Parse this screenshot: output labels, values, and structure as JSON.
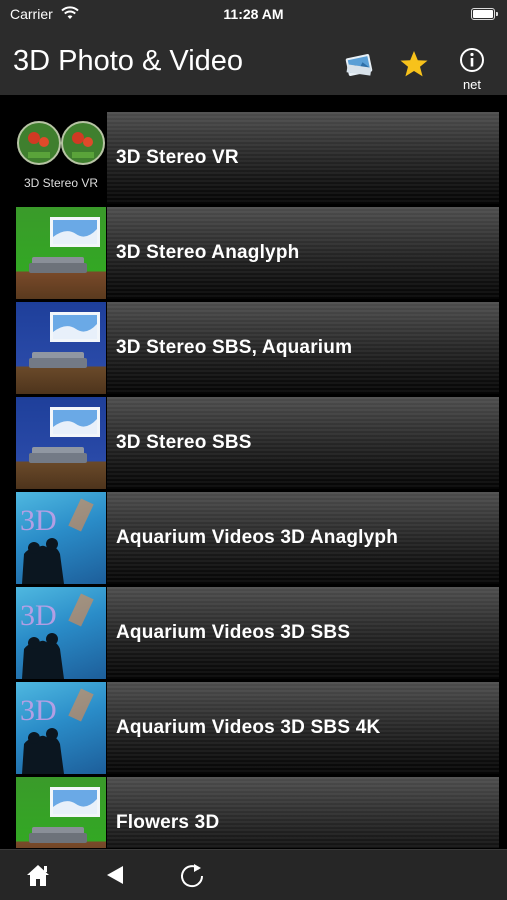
{
  "status_bar": {
    "carrier": "Carrier",
    "time": "11:28 AM"
  },
  "nav": {
    "title": "3D Photo & Video",
    "buttons": [
      {
        "icon": "photo-icon"
      },
      {
        "icon": "star-icon",
        "color": "#f7c21b"
      },
      {
        "icon": "info-icon",
        "label": "net"
      }
    ]
  },
  "items": [
    {
      "label": "3D Stereo VR",
      "thumb": "vr",
      "thumb_caption": "3D Stereo VR"
    },
    {
      "label": "3D Stereo Anaglyph",
      "thumb": "green-room"
    },
    {
      "label": "3D Stereo SBS, Aquarium",
      "thumb": "blue-room"
    },
    {
      "label": "3D Stereo SBS",
      "thumb": "blue-room"
    },
    {
      "label": "Aquarium Videos 3D Anaglyph",
      "thumb": "aquarium"
    },
    {
      "label": "Aquarium Videos 3D SBS",
      "thumb": "aquarium"
    },
    {
      "label": "Aquarium Videos 3D SBS 4K",
      "thumb": "aquarium"
    },
    {
      "label": "Flowers 3D",
      "thumb": "green-room"
    }
  ],
  "toolbar": {
    "buttons": [
      {
        "icon": "home-icon"
      },
      {
        "icon": "back-icon"
      },
      {
        "icon": "reload-icon"
      }
    ]
  }
}
